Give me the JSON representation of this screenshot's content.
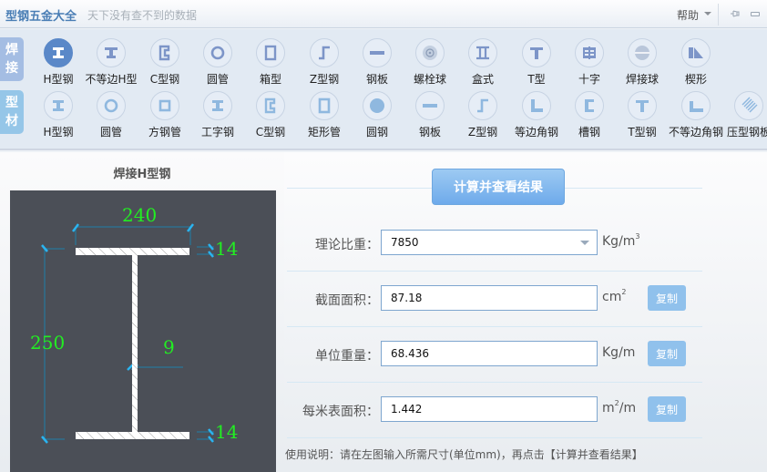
{
  "titlebar": {
    "title": "型钢五金大全",
    "slogan": "天下没有查不到的数据",
    "help": "帮助"
  },
  "categories": [
    {
      "label": "焊\n接",
      "line1": "焊",
      "line2": "接",
      "active": true
    },
    {
      "label": "型\n材",
      "line1": "型",
      "line2": "材",
      "active": false
    }
  ],
  "welded_items": [
    {
      "label": "H型钢",
      "icon": "h-beam-icon",
      "active": true
    },
    {
      "label": "不等边H型",
      "icon": "unequal-h-beam-icon"
    },
    {
      "label": "C型钢",
      "icon": "c-channel-icon"
    },
    {
      "label": "圆管",
      "icon": "round-tube-icon"
    },
    {
      "label": "箱型",
      "icon": "box-section-icon"
    },
    {
      "label": "Z型钢",
      "icon": "z-section-icon"
    },
    {
      "label": "钢板",
      "icon": "steel-plate-icon"
    },
    {
      "label": "螺栓球",
      "icon": "bolt-ball-icon"
    },
    {
      "label": "盒式",
      "icon": "box-type-icon"
    },
    {
      "label": "T型",
      "icon": "t-section-icon"
    },
    {
      "label": "十字",
      "icon": "cross-section-icon"
    },
    {
      "label": "焊接球",
      "icon": "welded-ball-icon"
    },
    {
      "label": "楔形",
      "icon": "wedge-icon"
    }
  ],
  "profile_items": [
    {
      "label": "H型钢",
      "icon": "h-beam-icon"
    },
    {
      "label": "圆管",
      "icon": "round-tube-icon"
    },
    {
      "label": "方钢管",
      "icon": "square-tube-icon"
    },
    {
      "label": "工字钢",
      "icon": "i-beam-icon"
    },
    {
      "label": "C型钢",
      "icon": "c-channel-icon"
    },
    {
      "label": "矩形管",
      "icon": "rect-tube-icon"
    },
    {
      "label": "圆钢",
      "icon": "round-bar-icon"
    },
    {
      "label": "钢板",
      "icon": "steel-plate-icon"
    },
    {
      "label": "Z型钢",
      "icon": "z-section-icon"
    },
    {
      "label": "等边角钢",
      "icon": "equal-angle-icon"
    },
    {
      "label": "槽钢",
      "icon": "channel-icon"
    },
    {
      "label": "T型钢",
      "icon": "t-beam-icon"
    },
    {
      "label": "不等边角钢",
      "icon": "unequal-angle-icon"
    },
    {
      "label": "压型钢板",
      "icon": "profiled-sheet-icon"
    }
  ],
  "drawing": {
    "title": "焊接H型钢",
    "flange_width": "240",
    "height": "250",
    "web_thickness": "9",
    "top_flange_thickness": "14",
    "bottom_flange_thickness": "14"
  },
  "form": {
    "calc_button": "计算并查看结果",
    "density": {
      "label": "理论比重：",
      "value": "7850",
      "unit_base": "Kg/m",
      "unit_sup": "3"
    },
    "area": {
      "label": "截面面积：",
      "value": "87.18",
      "unit_base": "cm",
      "unit_sup": "2",
      "copy": "复制"
    },
    "weight": {
      "label": "单位重量：",
      "value": "68.436",
      "unit_base": "Kg/m",
      "unit_sup": "",
      "copy": "复制"
    },
    "surface": {
      "label": "每米表面积：",
      "value": "1.442",
      "unit_base": "m",
      "unit_sup": "2",
      "unit_tail": "/m",
      "copy": "复制"
    },
    "usage": "使用说明：请在左图输入所需尺寸(单位mm)，再点击【计算并查看结果】"
  },
  "colors": {
    "accent": "#5a88c8",
    "dimension_text": "#22ee22",
    "drawing_bg": "#4b4f57",
    "copy_button": "#90c1ec"
  }
}
